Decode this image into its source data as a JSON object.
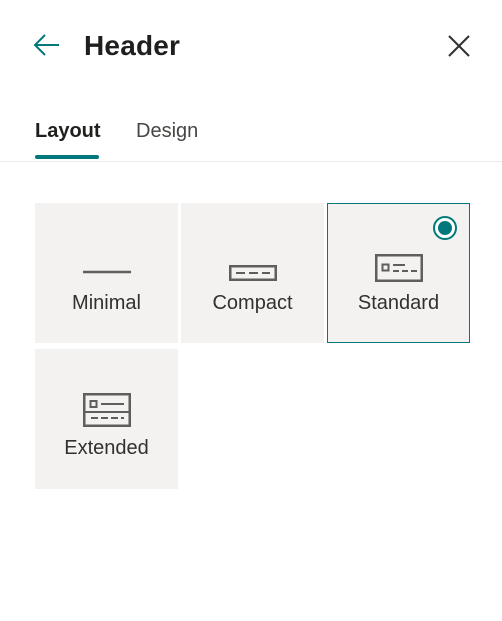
{
  "panel": {
    "title": "Header",
    "back_icon": "arrow-left-icon",
    "close_icon": "close-icon"
  },
  "tabs": [
    {
      "label": "Layout",
      "active": true
    },
    {
      "label": "Design",
      "active": false
    }
  ],
  "layouts": [
    {
      "label": "Minimal",
      "icon": "minimal-header-icon",
      "selected": false
    },
    {
      "label": "Compact",
      "icon": "compact-header-icon",
      "selected": false
    },
    {
      "label": "Standard",
      "icon": "standard-header-icon",
      "selected": true
    },
    {
      "label": "Extended",
      "icon": "extended-header-icon",
      "selected": false
    }
  ],
  "colors": {
    "accent": "#03787c",
    "tile_background": "#f3f2f1",
    "text": "#201f1e",
    "icon": "#605e5c"
  }
}
